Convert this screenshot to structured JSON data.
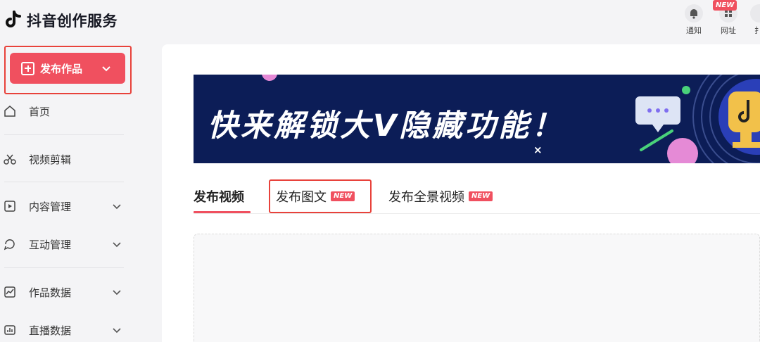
{
  "app": {
    "title": "抖音创作服务"
  },
  "sidebar": {
    "publish_label": "发布作品",
    "items": [
      {
        "label": "首页"
      },
      {
        "label": "视频剪辑"
      },
      {
        "label": "内容管理"
      },
      {
        "label": "互动管理"
      },
      {
        "label": "作品数据"
      },
      {
        "label": "直播数据"
      }
    ]
  },
  "topbar": {
    "notify_label": "通知",
    "website_label": "网址",
    "website_badge": "NEW",
    "third_label": "扌"
  },
  "banner": {
    "text": "快来解锁大V隐藏功能！",
    "close": "×"
  },
  "tabs": [
    {
      "label": "发布视频"
    },
    {
      "label": "发布图文",
      "badge": "NEW"
    },
    {
      "label": "发布全景视频",
      "badge": "NEW"
    }
  ],
  "colors": {
    "accent": "#f0505f",
    "banner_bg": "#0c1d57",
    "highlight": "#e8423b"
  }
}
